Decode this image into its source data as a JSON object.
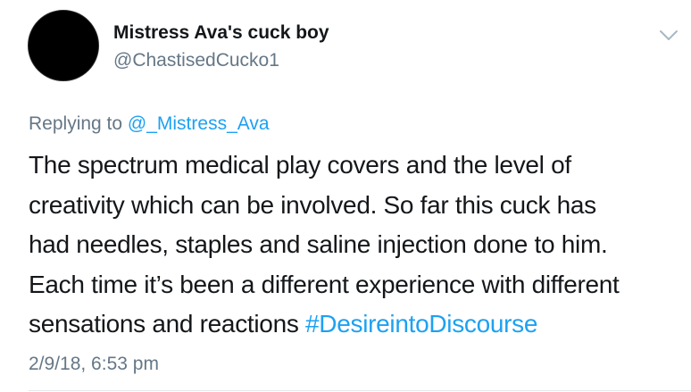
{
  "author": {
    "display_name": "Mistress Ava's cuck boy",
    "username": "@ChastisedCucko1"
  },
  "reply": {
    "prefix": "Replying to ",
    "mention": "@_Mistress_Ava"
  },
  "tweet": {
    "text": "The spectrum medical play covers and the level of\ncreativity which can be involved.   So far this cuck has\nhad needles, staples and saline injection done to him.\nEach time it’s been a different experience with different\nsensations and reactions ",
    "hashtag": "#DesireintoDiscourse",
    "timestamp": "2/9/18, 6:53 pm"
  },
  "icons": {
    "menu": "chevron-down-icon"
  },
  "colors": {
    "link": "#1da1f2",
    "secondary_text": "#657786",
    "primary_text": "#14171a",
    "divider": "#e1e8ed",
    "avatar": "#000000"
  }
}
